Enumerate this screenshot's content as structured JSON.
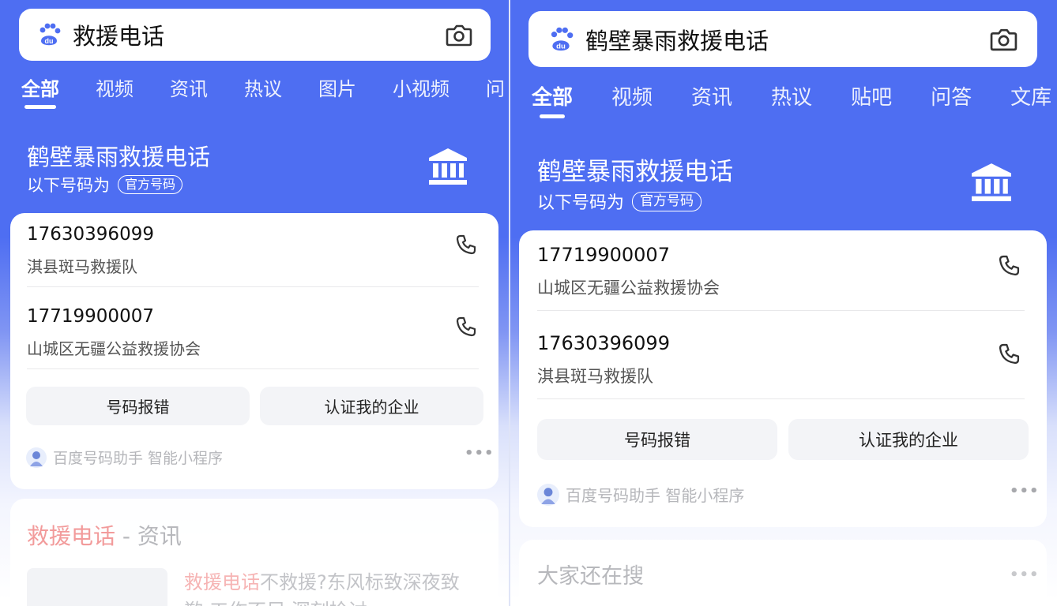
{
  "left": {
    "search": {
      "query": "救援电话"
    },
    "tabs": [
      "全部",
      "视频",
      "资讯",
      "热议",
      "图片",
      "小视频",
      "问"
    ],
    "hero": {
      "title": "鹤壁暴雨救援电话",
      "subtitle": "以下号码为",
      "badge": "官方号码"
    },
    "contacts": [
      {
        "number": "17630396099",
        "org": "淇县斑马救援队"
      },
      {
        "number": "17719900007",
        "org": "山城区无疆公益救援协会"
      }
    ],
    "buttons": {
      "report": "号码报错",
      "certify": "认证我的企业"
    },
    "helper": "百度号码助手 智能小程序",
    "news_card": {
      "title_highlight": "救援电话",
      "title_rest": " - 资讯",
      "headline_highlight": "救援电话",
      "headline_rest": "不救援?东风标致深夜致",
      "headline_line2": "歉:工作不足 深刻检讨"
    }
  },
  "right": {
    "search": {
      "query": "鹤壁暴雨救援电话"
    },
    "tabs": [
      "全部",
      "视频",
      "资讯",
      "热议",
      "贴吧",
      "问答",
      "文库"
    ],
    "hero": {
      "title": "鹤壁暴雨救援电话",
      "subtitle": "以下号码为",
      "badge": "官方号码"
    },
    "contacts": [
      {
        "number": "17719900007",
        "org": "山城区无疆公益救援协会"
      },
      {
        "number": "17630396099",
        "org": "淇县斑马救援队"
      }
    ],
    "buttons": {
      "report": "号码报错",
      "certify": "认证我的企业"
    },
    "helper": "百度号码助手 智能小程序",
    "also_search": {
      "title": "大家还在搜"
    }
  },
  "colors": {
    "brand_blue": "#4e6ef2",
    "highlight_red": "#f29b9b"
  },
  "icons": [
    "baidu-paw-icon",
    "camera-icon",
    "bank-building-icon",
    "phone-icon",
    "more-dots-icon"
  ]
}
